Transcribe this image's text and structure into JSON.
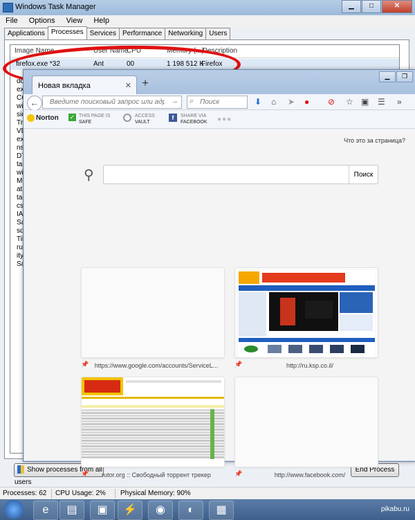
{
  "task_manager": {
    "title": "Windows Task Manager",
    "menu": [
      "File",
      "Options",
      "View",
      "Help"
    ],
    "tabs": [
      "Applications",
      "Processes",
      "Services",
      "Performance",
      "Networking",
      "Users"
    ],
    "columns": [
      "Image Name",
      "User Name",
      "CPU",
      "Memory (...)",
      "Description"
    ],
    "selected_row": {
      "image": "firefox.exe *32",
      "user": "Ant",
      "cpu": "00",
      "memory": "1 198 512 K",
      "description": "Firefox"
    },
    "visible_left_fragments": [
      "dc",
      "ex",
      "CC",
      "wi",
      "sid",
      "Tr",
      "VD",
      "ex",
      "ns",
      "DT",
      "tas",
      "wi",
      "MC",
      "ati",
      "tas",
      "csi",
      "IA",
      "Sa",
      "sdl",
      "Tib",
      "rus",
      "ity",
      "Sa"
    ],
    "show_all_button": "Show processes from all users",
    "end_process_button": "End Process",
    "status": {
      "processes": "Processes: 62",
      "cpu": "CPU Usage: 2%",
      "memory": "Physical Memory: 90%"
    }
  },
  "firefox": {
    "tab_title": "Новая вкладка",
    "url_placeholder": "Введите поисковый запрос или адрес",
    "search_placeholder": "Поиск",
    "norton": {
      "brand": "Norton",
      "safe_top": "THIS PAGE IS",
      "safe_bottom": "SAFE",
      "vault_top": "ACCESS",
      "vault_bottom": "VAULT",
      "share_top": "SHARE VIA",
      "share_bottom": "FACEBOOK"
    },
    "what_is_page": "Что это за страница?",
    "search_button": "Поиск",
    "tiles": [
      {
        "label": "https://www.google.com/accounts/ServiceL..."
      },
      {
        "label": "http://ru.ksp.co.il/"
      },
      {
        "label": "rutor.org :: Свободный торрент трекер"
      },
      {
        "label": "http://www.facebook.com/"
      }
    ]
  },
  "watermark": "pikabu.ru"
}
